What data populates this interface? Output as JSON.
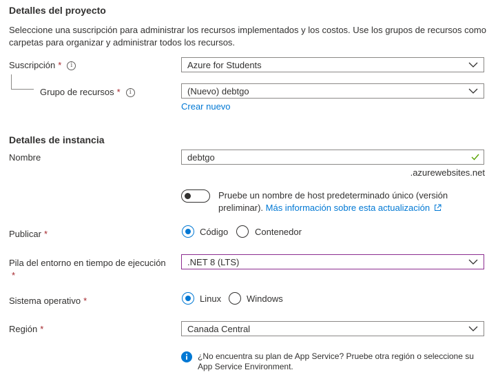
{
  "project": {
    "heading": "Detalles del proyecto",
    "description": "Seleccione una suscripción para administrar los recursos implementados y los costos. Use los grupos de recursos como carpetas para organizar y administrar todos los recursos.",
    "subscription": {
      "label": "Suscripción",
      "value": "Azure for Students"
    },
    "resource_group": {
      "label": "Grupo de recursos",
      "value": "(Nuevo) debtgo",
      "create_link": "Crear nuevo"
    }
  },
  "instance": {
    "heading": "Detalles de instancia",
    "name": {
      "label": "Nombre",
      "value": "debtgo",
      "suffix": ".azurewebsites.net"
    },
    "hostname_toggle": {
      "text_line1": "Pruebe un nombre de host predeterminado único (versión",
      "text_line2": "preliminar).",
      "link": "Más información sobre esta actualización",
      "on": false
    },
    "publish": {
      "label": "Publicar",
      "options": [
        "Código",
        "Contenedor"
      ],
      "selected": "Código"
    },
    "runtime": {
      "label": "Pila del entorno en tiempo de ejecución",
      "value": ".NET 8 (LTS)"
    },
    "os": {
      "label": "Sistema operativo",
      "options": [
        "Linux",
        "Windows"
      ],
      "selected": "Linux"
    },
    "region": {
      "label": "Región",
      "value": "Canada Central",
      "info_line1": "¿No encuentra su plan de App Service? Pruebe otra región o seleccione su",
      "info_line2": "App Service Environment."
    }
  },
  "required_marker": "*",
  "colors": {
    "accent": "#0078d4",
    "required": "#a4262c",
    "focus_border": "#8b2b8f",
    "valid": "#57a300"
  }
}
